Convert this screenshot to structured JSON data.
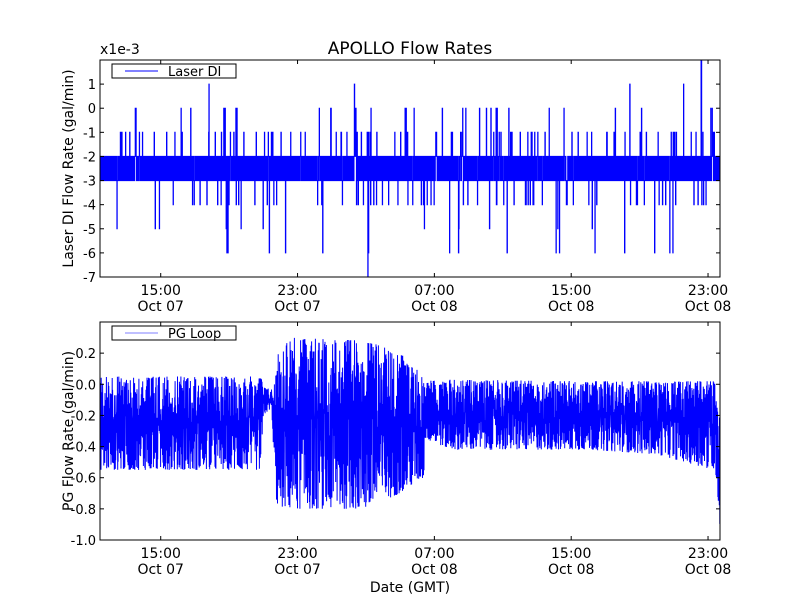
{
  "chart_data": [
    {
      "type": "line",
      "title": "APOLLO Flow Rates",
      "ylabel": "Laser DI Flow Rate (gal/min)",
      "y_offset_label": "x1e-3",
      "y_scale": 0.001,
      "ylim": [
        -7,
        2
      ],
      "yticks": [
        1,
        0,
        -1,
        -2,
        -3,
        -4,
        -5,
        -6,
        -7
      ],
      "ytick_labels": [
        "1",
        "0",
        "-1",
        "-2",
        "-3",
        "-4",
        "-5",
        "-6",
        "-7"
      ],
      "x_unit": "hours since Oct 07 00:00 GMT",
      "xlim": [
        11.45,
        47.7
      ],
      "xticks": [
        15,
        23,
        31,
        39,
        47
      ],
      "xtick_labels": [
        [
          "15:00",
          "Oct 07"
        ],
        [
          "23:00",
          "Oct 07"
        ],
        [
          "07:00",
          "Oct 08"
        ],
        [
          "15:00",
          "Oct 08"
        ],
        [
          "23:00",
          "Oct 08"
        ]
      ],
      "legend": {
        "label": "Laser DI",
        "placement": "top-left"
      },
      "series": [
        {
          "name": "Laser DI",
          "color": "#0000ff",
          "description_values": {
            "dominant_band": [
              -3,
              -2
            ],
            "frequent_excursions": [
              -1,
              -4
            ],
            "occasional_excursions": [
              0,
              -5
            ],
            "rare_excursions": [
              1,
              -6
            ],
            "extremes": [
              {
                "hour": 46.6,
                "value": 2
              },
              {
                "hour": 27.1,
                "value": -7
              }
            ]
          }
        }
      ]
    },
    {
      "type": "line",
      "ylabel": "PG Flow Rate (gal/min)",
      "xlabel": "Date (GMT)",
      "ylim": [
        -1.0,
        0.4
      ],
      "yticks": [
        0.2,
        0.0,
        -0.2,
        -0.4,
        -0.6,
        -0.8,
        -1.0
      ],
      "ytick_labels": [
        "0.2",
        "0.0",
        "-0.2",
        "-0.4",
        "-0.6",
        "-0.8",
        "-1.0"
      ],
      "x_unit": "hours since Oct 07 00:00 GMT",
      "xlim": [
        11.45,
        47.7
      ],
      "xticks": [
        15,
        23,
        31,
        39,
        47
      ],
      "xtick_labels": [
        [
          "15:00",
          "Oct 07"
        ],
        [
          "23:00",
          "Oct 07"
        ],
        [
          "07:00",
          "Oct 08"
        ],
        [
          "15:00",
          "Oct 08"
        ],
        [
          "23:00",
          "Oct 08"
        ]
      ],
      "legend": {
        "label": "PG Loop",
        "placement": "top-left"
      },
      "series": [
        {
          "name": "PG Loop",
          "color": "#0000ff",
          "envelope_hour_low_high": [
            [
              11.45,
              -0.55,
              0.05
            ],
            [
              20.9,
              -0.55,
              0.05
            ],
            [
              21.0,
              -0.2,
              -0.02
            ],
            [
              21.5,
              -0.15,
              -0.03
            ],
            [
              21.6,
              -0.55,
              -0.05
            ],
            [
              21.8,
              -0.78,
              0.2
            ],
            [
              22.5,
              -0.8,
              0.3
            ],
            [
              27.0,
              -0.8,
              0.28
            ],
            [
              29.0,
              -0.7,
              0.2
            ],
            [
              30.4,
              -0.6,
              0.05
            ],
            [
              30.45,
              -0.35,
              0.02
            ],
            [
              32.0,
              -0.42,
              0.03
            ],
            [
              40.0,
              -0.42,
              0.02
            ],
            [
              44.0,
              -0.45,
              0.02
            ],
            [
              47.3,
              -0.55,
              0.02
            ],
            [
              47.5,
              -0.6,
              0.0
            ],
            [
              47.7,
              -0.95,
              -0.2
            ]
          ]
        }
      ]
    }
  ]
}
